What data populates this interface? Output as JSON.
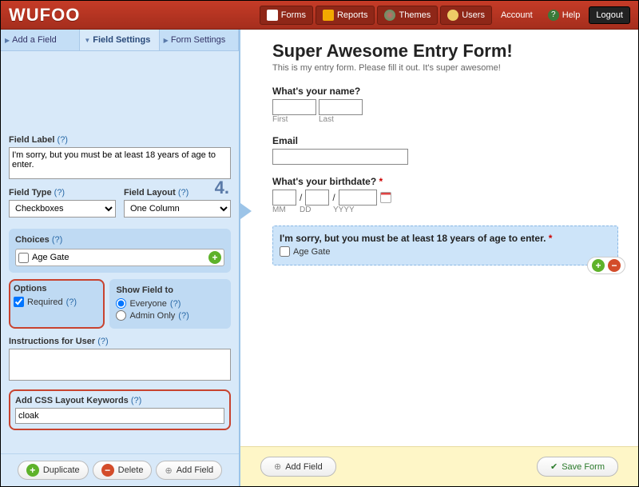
{
  "brand": {
    "p1": "WU",
    "mid": "F",
    "p2": "OO"
  },
  "nav": {
    "forms": "Forms",
    "reports": "Reports",
    "themes": "Themes",
    "users": "Users",
    "account": "Account",
    "help": "Help",
    "logout": "Logout"
  },
  "tabs": {
    "add": "Add a Field",
    "settings": "Field Settings",
    "form": "Form Settings"
  },
  "step": "4.",
  "sidebar": {
    "fieldLabel_title": "Field Label",
    "fieldLabel_help": "(?)",
    "fieldLabel_value": "I'm sorry, but you must be at least 18 years of age to enter.",
    "fieldType_title": "Field Type",
    "fieldType_value": "Checkboxes",
    "fieldLayout_title": "Field Layout",
    "fieldLayout_value": "One Column",
    "choices_title": "Choices",
    "choice1": "Age Gate",
    "options_title": "Options",
    "required_label": "Required",
    "required_checked": true,
    "showfield_title": "Show Field to",
    "everyone": "Everyone",
    "admin": "Admin Only",
    "instructions_title": "Instructions for User",
    "instructions_value": "",
    "css_title": "Add CSS Layout Keywords",
    "css_value": "cloak",
    "dup": "Duplicate",
    "del": "Delete",
    "addfield": "Add Field"
  },
  "preview": {
    "title": "Super Awesome Entry Form!",
    "desc": "This is my entry form. Please fill it out. It's super awesome!",
    "name_label": "What's your name?",
    "first": "First",
    "last": "Last",
    "email_label": "Email",
    "bd_label": "What's your birthdate?",
    "slash": "/",
    "mm": "MM",
    "dd": "DD",
    "yyyy": "YYYY",
    "agegate_label": "I'm sorry, but you must be at least 18 years of age to enter.",
    "agegate_option": "Age Gate",
    "addfield": "Add Field",
    "save": "Save Form"
  }
}
